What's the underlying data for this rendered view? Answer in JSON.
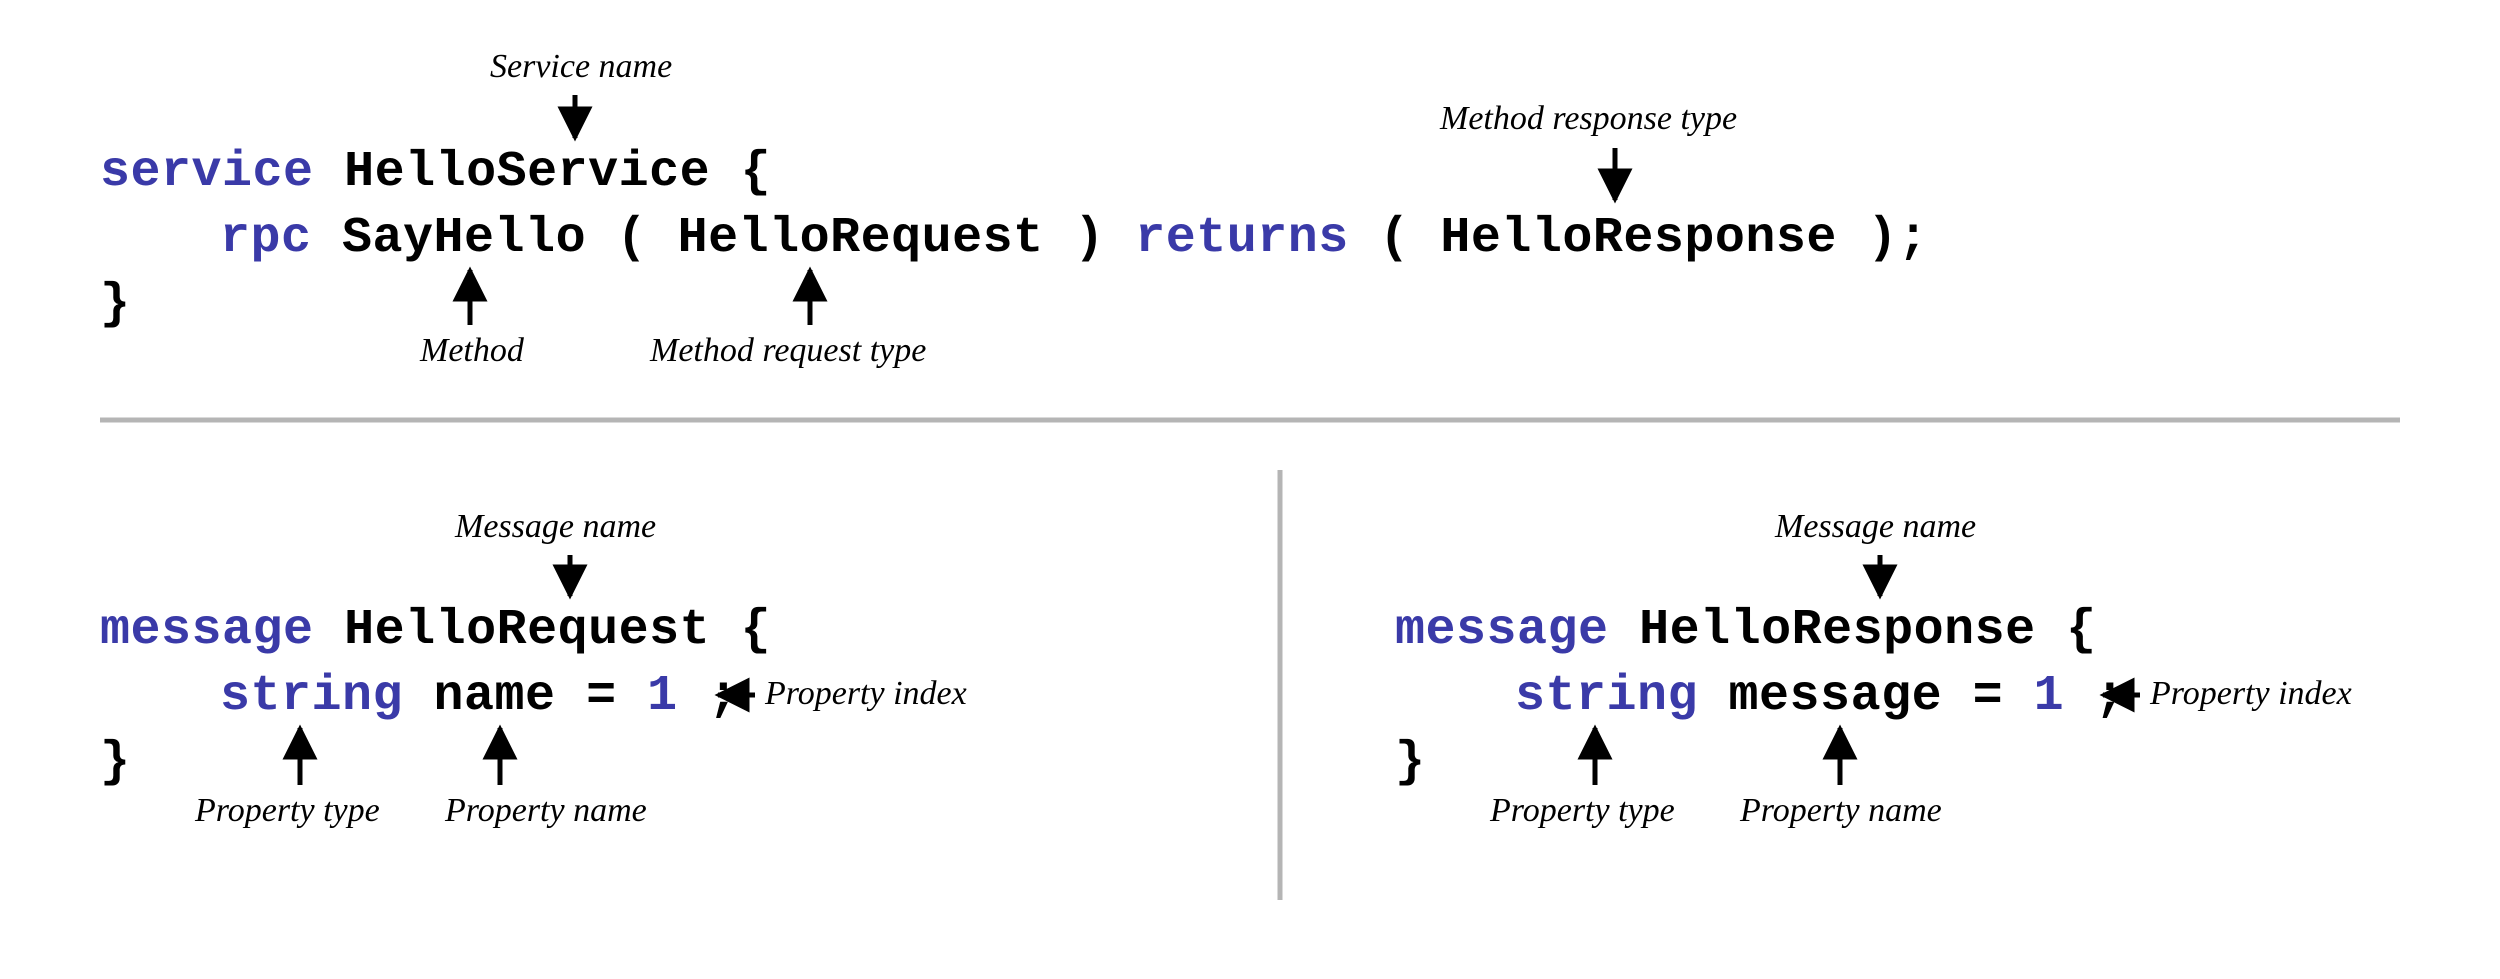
{
  "service": {
    "keyword_service": "service",
    "name": "HelloService",
    "open_brace": "{",
    "rpc_keyword": "rpc",
    "method_name": "SayHello",
    "open_paren1": "(",
    "request_type": "HelloRequest",
    "close_paren1": ")",
    "returns_keyword": "returns",
    "open_paren2": "(",
    "response_type": "HelloResponse",
    "close_paren2_semi": ");",
    "close_brace": "}"
  },
  "msg_req": {
    "keyword_message": "message",
    "name": "HelloRequest",
    "open_brace": "{",
    "prop_type": "string",
    "prop_name": "name",
    "equals": " = ",
    "prop_index": "1",
    "semi": ";",
    "close_brace": "}"
  },
  "msg_res": {
    "keyword_message": "message",
    "name": "HelloResponse",
    "open_brace": "{",
    "prop_type": "string",
    "prop_name": "message",
    "equals": " = ",
    "prop_index": "1",
    "semi": ";",
    "close_brace": "}"
  },
  "labels": {
    "service_name": "Service name",
    "method": "Method",
    "method_request_type": "Method request type",
    "method_response_type": "Method response type",
    "message_name": "Message name",
    "property_type": "Property type",
    "property_name": "Property name",
    "property_index": "Property index"
  }
}
